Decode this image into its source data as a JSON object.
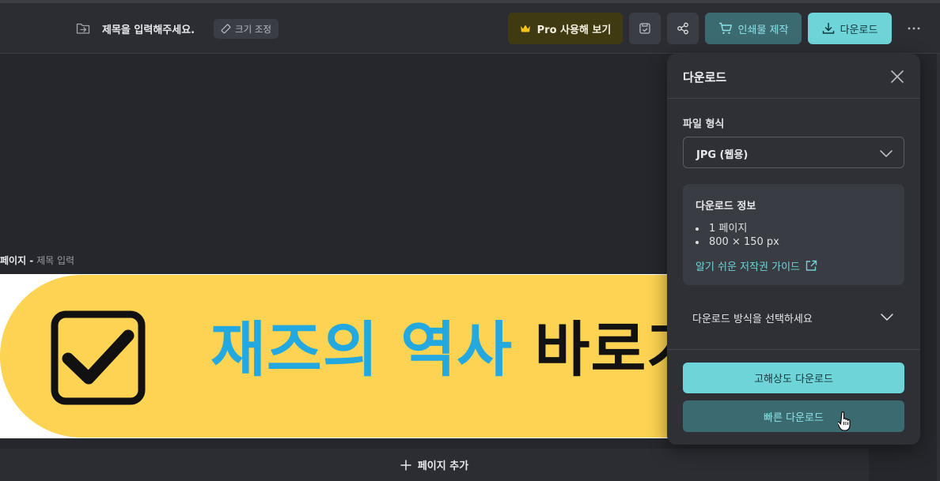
{
  "header": {
    "document_title": "제목을 입력해주세요.",
    "resize_label": "크기 조정",
    "pro_label": "Pro 사용해 보기",
    "print_label": "인쇄물 제작",
    "download_label": "다운로드"
  },
  "canvas": {
    "page_number": "페이지 -",
    "page_title_placeholder": "제목 입력",
    "banner_text_blue": "재즈의 역사",
    "banner_text_black": "바로가기",
    "add_page_label": "페이지 추가",
    "colors": {
      "banner": "#fcd352",
      "accent_blue": "#24a8e0"
    }
  },
  "download_panel": {
    "title": "다운로드",
    "file_format_label": "파일 형식",
    "file_format_value": "JPG (웹용)",
    "info_title": "다운로드 정보",
    "info_items": [
      "1 페이지",
      "800 × 150 px"
    ],
    "guide_link": "알기 쉬운 저작권 가이드",
    "method_prompt": "다운로드 방식을 선택하세요",
    "hq_download_label": "고해상도 다운로드",
    "fast_download_label": "빠른 다운로드"
  },
  "theme": {
    "accent": "#6fd4d8",
    "accent_dark": "#3b6a70",
    "pro": "#3f3a12"
  }
}
